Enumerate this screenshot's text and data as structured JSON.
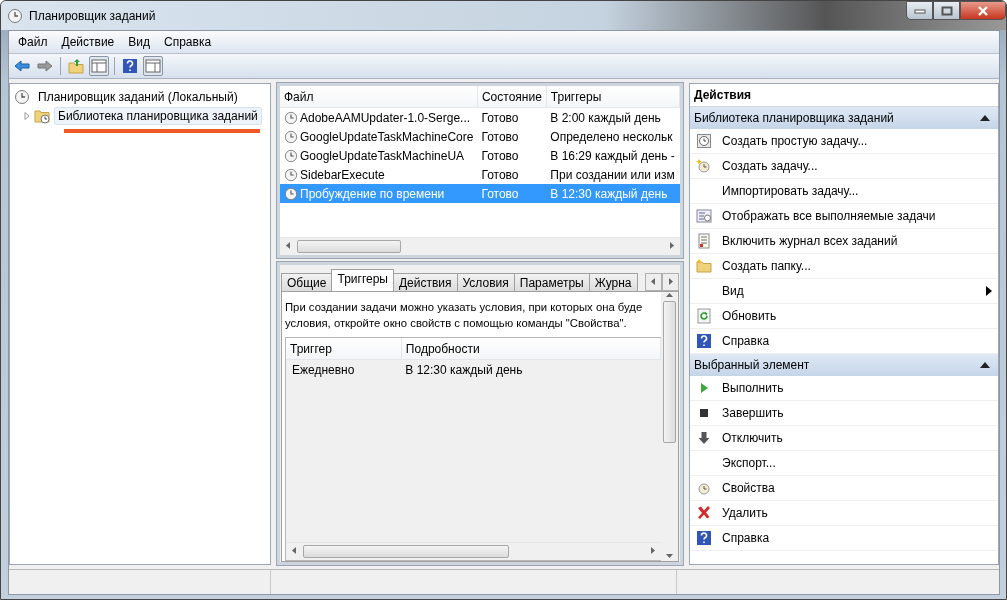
{
  "window": {
    "title": "Планировщик заданий"
  },
  "menu": [
    "Файл",
    "Действие",
    "Вид",
    "Справка"
  ],
  "tree": [
    {
      "label": "Планировщик заданий (Локальный)",
      "expanded": true,
      "selected": false,
      "children": [
        {
          "label": "Библиотека планировщика заданий",
          "expanded": false,
          "selected": true,
          "underlined": true
        }
      ]
    }
  ],
  "tasks": {
    "columns": [
      "Файл",
      "Состояние",
      "Триггеры"
    ],
    "rows": [
      {
        "name": "AdobeAAMUpdater-1.0-Serge...",
        "state": "Готово",
        "trigger": "В 2:00 каждый день",
        "selected": false
      },
      {
        "name": "GoogleUpdateTaskMachineCore",
        "state": "Готово",
        "trigger": "Определено нескольк",
        "selected": false
      },
      {
        "name": "GoogleUpdateTaskMachineUA",
        "state": "Готово",
        "trigger": "В 16:29 каждый день -",
        "selected": false
      },
      {
        "name": "SidebarExecute",
        "state": "Готово",
        "trigger": "При создании или изм",
        "selected": false
      },
      {
        "name": "Пробуждение по времени",
        "state": "Готово",
        "trigger": "В 12:30 каждый день",
        "selected": true
      }
    ]
  },
  "tabs": [
    {
      "label": "Общие",
      "selected": false
    },
    {
      "label": "Триггеры",
      "selected": true
    },
    {
      "label": "Действия",
      "selected": false
    },
    {
      "label": "Условия",
      "selected": false
    },
    {
      "label": "Параметры",
      "selected": false
    },
    {
      "label": "Журна",
      "selected": false
    }
  ],
  "description": [
    "При создании задачи можно указать условия, при которых она буде",
    "условия, откройте окно свойств с помощью команды \"Свойства\"."
  ],
  "triggers": {
    "columns": [
      "Триггер",
      "Подробности"
    ],
    "rows": [
      {
        "trigger": "Ежедневно",
        "details": "В 12:30 каждый день"
      }
    ]
  },
  "actions": {
    "title": "Действия",
    "sections": [
      {
        "title": "Библиотека планировщика заданий",
        "expanded": true,
        "items": [
          {
            "kind": "wizard",
            "label": "Создать простую задачу..."
          },
          {
            "kind": "task",
            "label": "Создать задачу..."
          },
          {
            "kind": "plain",
            "label": "Импортировать задачу..."
          },
          {
            "kind": "running",
            "label": "Отображать все выполняемые задачи"
          },
          {
            "kind": "log",
            "label": "Включить журнал всех заданий"
          },
          {
            "kind": "folder",
            "label": "Создать папку..."
          },
          {
            "kind": "submenu",
            "label": "Вид"
          },
          {
            "kind": "refresh",
            "label": "Обновить"
          },
          {
            "kind": "help",
            "label": "Справка"
          }
        ]
      },
      {
        "title": "Выбранный элемент",
        "expanded": true,
        "items": [
          {
            "kind": "run",
            "label": "Выполнить"
          },
          {
            "kind": "stop",
            "label": "Завершить"
          },
          {
            "kind": "disable",
            "label": "Отключить"
          },
          {
            "kind": "plain",
            "label": "Экспорт..."
          },
          {
            "kind": "properties",
            "label": "Свойства"
          },
          {
            "kind": "delete",
            "label": "Удалить"
          },
          {
            "kind": "help",
            "label": "Справка"
          }
        ]
      }
    ]
  }
}
